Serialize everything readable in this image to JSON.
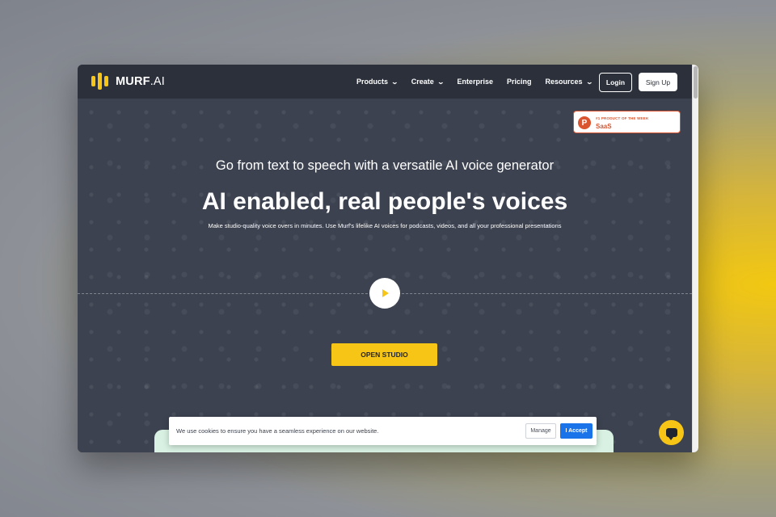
{
  "nav": {
    "logo_main": "MURF",
    "logo_suffix": ".AI",
    "links": [
      {
        "label": "Products",
        "has_dropdown": true
      },
      {
        "label": "Create",
        "has_dropdown": true
      },
      {
        "label": "Enterprise",
        "has_dropdown": false
      },
      {
        "label": "Pricing",
        "has_dropdown": false
      },
      {
        "label": "Resources",
        "has_dropdown": true
      }
    ],
    "login_label": "Login",
    "signup_label": "Sign Up",
    "chevron_glyph": "⌄"
  },
  "badge": {
    "icon_letter": "P",
    "top_text": "#1 PRODUCT OF THE WEEK",
    "bottom_text": "SaaS"
  },
  "hero": {
    "subtitle": "Go from text to speech with a versatile AI voice generator",
    "headline": "AI enabled, real people's voices",
    "description": "Make studio-quality voice overs in minutes. Use Murf's lifelike AI voices for podcasts, videos, and all your professional presentations",
    "cta_label": "OPEN STUDIO"
  },
  "cookie": {
    "text": "We use cookies to ensure you have a seamless experience on our website.",
    "manage_label": "Manage",
    "accept_label": "I Accept"
  },
  "colors": {
    "accent_yellow": "#f7c515",
    "nav_bg": "#2b303b",
    "hero_bg": "#3c4250",
    "accept_blue": "#1a73e8",
    "producthunt_orange": "#da552f"
  },
  "icons": [
    "murf-logo-icon",
    "chevron-down-icon",
    "producthunt-icon",
    "play-icon",
    "chat-icon"
  ]
}
